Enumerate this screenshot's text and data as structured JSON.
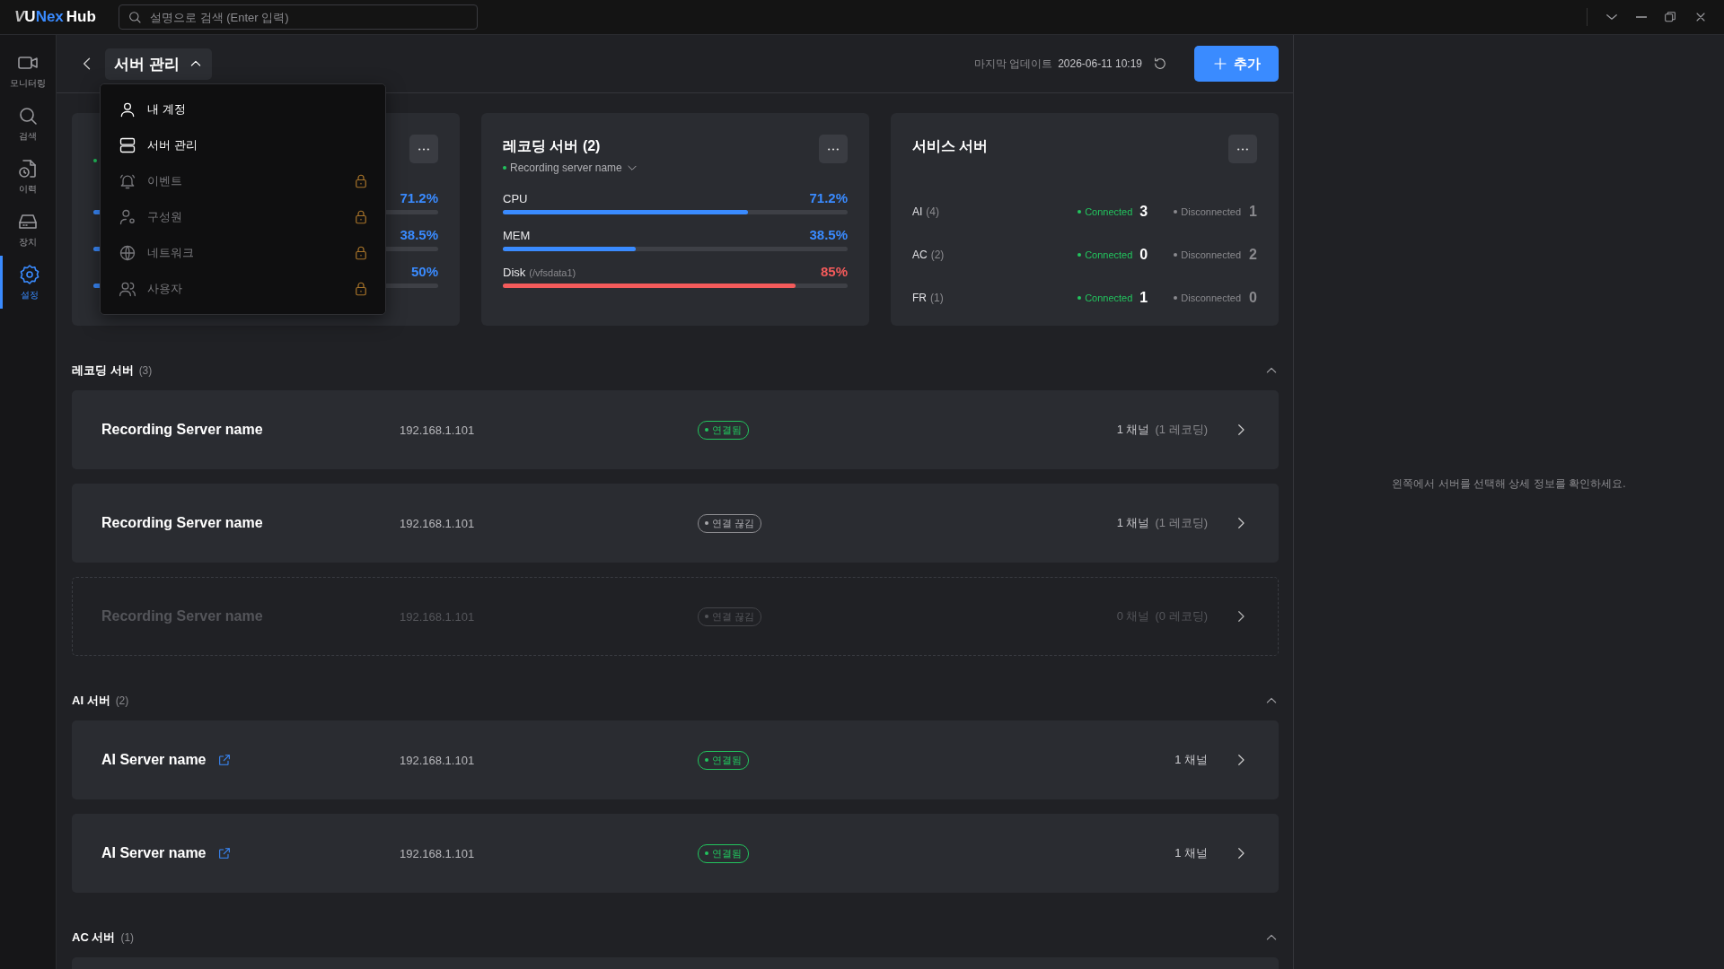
{
  "app": {
    "logo_v": "V",
    "logo_u": "U",
    "logo_nex": "Nex",
    "logo_hub": "Hub",
    "search": {
      "placeholder": "설명으로 검색 (Enter 입력)"
    }
  },
  "sidebar": {
    "items": [
      {
        "label": "모니터링",
        "selected": false
      },
      {
        "label": "검색",
        "selected": false
      },
      {
        "label": "이력",
        "selected": false
      },
      {
        "label": "장치",
        "selected": false
      },
      {
        "label": "설정",
        "selected": true
      }
    ]
  },
  "header": {
    "title": "서버 관리",
    "expanded": true,
    "last_update_label": "마지막 업데이트",
    "last_update": "2026-06-11 10:19",
    "add_button": "추가"
  },
  "menu": {
    "items": [
      {
        "label": "내 계정",
        "locked": false
      },
      {
        "label": "서버 관리",
        "locked": false
      },
      {
        "label": "이벤트",
        "locked": true
      },
      {
        "label": "구성원",
        "locked": true
      },
      {
        "label": "네트워크",
        "locked": true
      },
      {
        "label": "사용자",
        "locked": true
      }
    ]
  },
  "cards": [
    {
      "kind": "metrics",
      "status_dot": true,
      "metrics": [
        {
          "value": "71.2%",
          "level": 0.712,
          "critical": false
        },
        {
          "value": "38.5%",
          "level": 0.385,
          "critical": false
        },
        {
          "value": "50%",
          "level": 0.5,
          "critical": false
        }
      ]
    },
    {
      "kind": "metrics",
      "title": "레코딩 서버 (2)",
      "status_dot": true,
      "subtitle": "Recording server name",
      "metrics": [
        {
          "label": "CPU",
          "value": "71.2%",
          "level": 0.712,
          "critical": false
        },
        {
          "label": "MEM",
          "value": "38.5%",
          "level": 0.385,
          "critical": false
        },
        {
          "label": "Disk",
          "sublabel": "(/vfsdata1)",
          "value": "85%",
          "level": 0.85,
          "critical": true
        }
      ]
    },
    {
      "kind": "services",
      "title": "서비스 서버",
      "rows": [
        {
          "name": "AI",
          "count": "(4)",
          "connected_label": "Connected",
          "connected": "3",
          "disconnected_label": "Disconnected",
          "disconnected": "1"
        },
        {
          "name": "AC",
          "count": "(2)",
          "connected_label": "Connected",
          "connected": "0",
          "disconnected_label": "Disconnected",
          "disconnected": "2"
        },
        {
          "name": "FR",
          "count": "(1)",
          "connected_label": "Connected",
          "connected": "1",
          "disconnected_label": "Disconnected",
          "disconnected": "0"
        }
      ]
    }
  ],
  "sections": [
    {
      "title": "레코딩 서버",
      "count": "(3)",
      "expanded": true,
      "servers": [
        {
          "name": "Recording Server name",
          "external_link": false,
          "ip": "192.168.1.101",
          "status": "연결됨",
          "kind": "connected",
          "disabled": false,
          "channels": "1 채널",
          "recording": "(1 레코딩)"
        },
        {
          "name": "Recording Server name",
          "external_link": false,
          "ip": "192.168.1.101",
          "status": "연결 끊김",
          "kind": "disconnected",
          "disabled": false,
          "channels": "1 채널",
          "recording": "(1 레코딩)"
        },
        {
          "name": "Recording Server name",
          "external_link": false,
          "ip": "192.168.1.101",
          "status": "연결 끊김",
          "kind": "disconnected",
          "disabled": true,
          "channels": "0 채널",
          "recording": "(0 레코딩)"
        }
      ]
    },
    {
      "title": "AI 서버",
      "count": "(2)",
      "expanded": true,
      "servers": [
        {
          "name": "AI Server name",
          "external_link": true,
          "ip": "192.168.1.101",
          "status": "연결됨",
          "kind": "connected",
          "disabled": false,
          "channels": "1 채널"
        },
        {
          "name": "AI Server name",
          "external_link": true,
          "ip": "192.168.1.101",
          "status": "연결됨",
          "kind": "connected",
          "disabled": false,
          "channels": "1 채널"
        }
      ]
    },
    {
      "title": "AC 서버",
      "count": "(1)",
      "expanded": true,
      "servers": [
        {
          "kind": "placeholder"
        }
      ]
    }
  ],
  "detail": {
    "empty_message": "왼쪽에서 서버를 선택해 상세 정보를 확인하세요."
  }
}
